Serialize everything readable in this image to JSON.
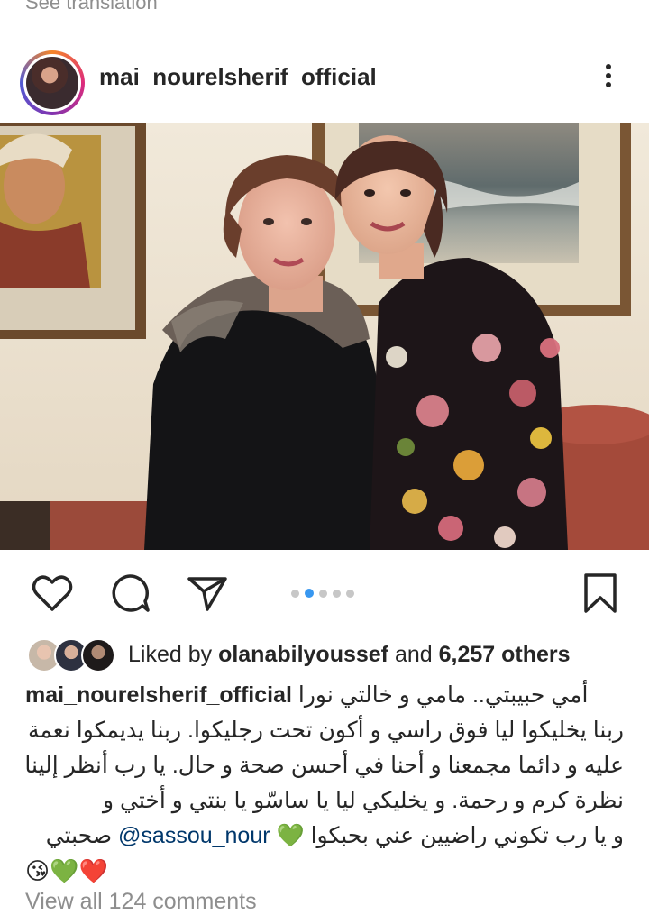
{
  "top": {
    "see_translation": "See translation"
  },
  "post": {
    "username": "mai_nourelsherif_official",
    "more_icon": "more-vertical-icon",
    "image_count": 5,
    "active_image_index": 1
  },
  "actions": {
    "like_icon": "heart-icon",
    "comment_icon": "comment-icon",
    "share_icon": "send-icon",
    "save_icon": "bookmark-icon"
  },
  "likes": {
    "prefix": "Liked by ",
    "user": "olanabilyoussef",
    "middle": " and ",
    "count": "6,257 others"
  },
  "caption": {
    "username": "mai_nourelsherif_official",
    "line1": "أمي حبيبتي.. مامي و خالتي نورا",
    "line2": "ربنا يخليكوا ليا فوق راسي و أكون تحت رجليكوا. ربنا يديمكوا نعمة",
    "line3": "عليه و دائما مجمعنا و أحنا في أحسن صحة و حال. يا رب أنظر إلينا",
    "line4": "نظرة كرم و رحمة. و يخليكي ليا يا ساسّو يا بنتي و أختي و",
    "line5_start": "و يا رب تكوني راضيين عني بحبكوا",
    "line5_heart": "💚",
    "mention": "@sassou_nour",
    "line5_end": "صحبتي",
    "emojis": "😘💚❤️"
  },
  "comments": {
    "view_all": "View all 124 comments"
  },
  "colors": {
    "text": "#262626",
    "muted": "#8e8e8e",
    "mention": "#00376b",
    "active_dot": "#3897f0",
    "inactive_dot": "#c7c7c7"
  }
}
